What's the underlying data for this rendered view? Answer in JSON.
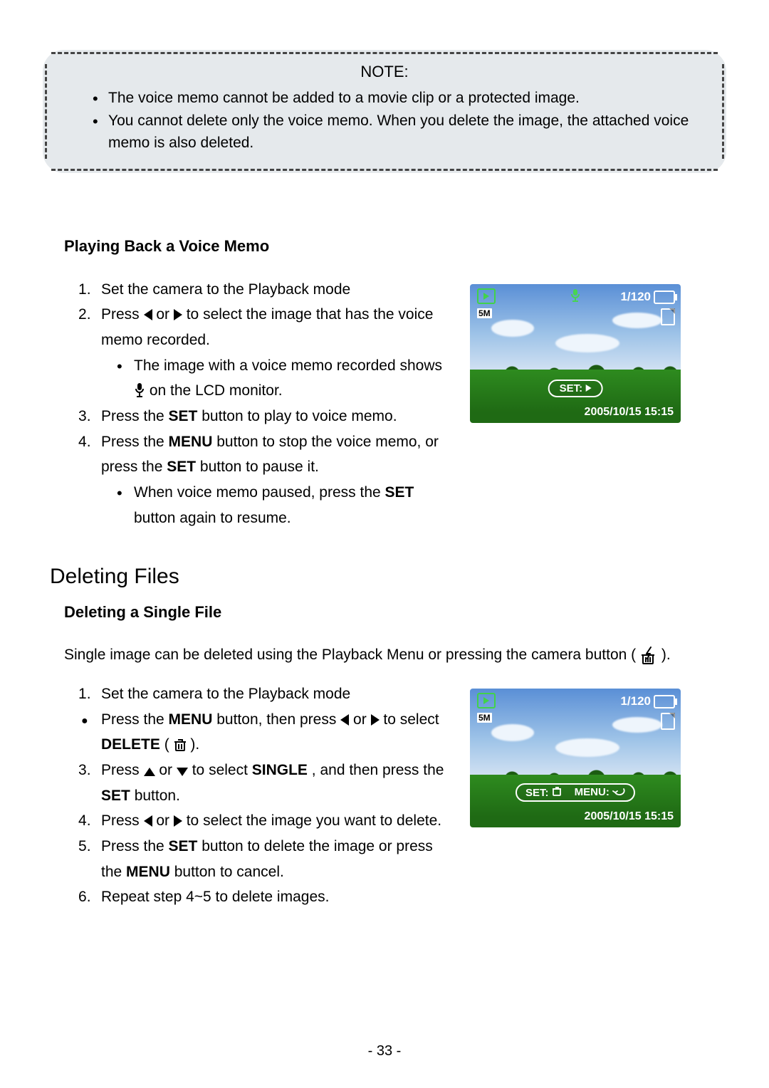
{
  "note": {
    "title": "NOTE:",
    "items": [
      "The voice memo cannot be added to a movie clip or a protected image.",
      "You cannot delete only the voice memo. When you delete the image, the attached voice memo is also deleted."
    ]
  },
  "subhead_play": "Playing Back a Voice Memo",
  "play_steps": {
    "s1": "Set the camera to the Playback mode",
    "s2a": "Press ",
    "s2b": " or ",
    "s2c": " to select the image that has the voice memo recorded.",
    "s2_bullet_a": "The image with a voice memo recorded shows ",
    "s2_bullet_b": " on the LCD monitor.",
    "s3a": "Press the ",
    "s3b": " button to play to voice memo.",
    "s4a": "Press the ",
    "s4b": " button to stop the voice memo, or press the ",
    "s4c": " button to pause it.",
    "s4_bullet_a": "When voice memo paused, press the ",
    "s4_bullet_b": " button again to resume."
  },
  "words": {
    "SET": "SET",
    "MENU": "MENU",
    "DELETE": "DELETE",
    "SINGLE": "SINGLE"
  },
  "lcd1": {
    "resolution": "5M",
    "count": "1/120",
    "pill_set": "SET:",
    "timestamp": "2005/10/15  15:15"
  },
  "section_delete": "Deleting Files",
  "subhead_del1": "Deleting a Single File",
  "del_intro_a": "Single image can be deleted using the Playback Menu or pressing the camera button ( ",
  "del_intro_b": ").",
  "del_steps": {
    "s1": "Set the camera to the Playback mode",
    "s1b_a": "Press the ",
    "s1b_b": " button, then press ",
    "s1b_c": " or ",
    "s1b_d": " to select ",
    "s1b_e": " ( ",
    "s1b_f": ").",
    "s2a": "Press ",
    "s2b": " or ",
    "s2c": " to select ",
    "s2d": ", and then press the ",
    "s2e": " button.",
    "s3a": "Press ",
    "s3b": " or ",
    "s3c": " to select the image you want to delete.",
    "s4a": "Press the ",
    "s4b": " button to delete the image or press the ",
    "s4c": " button to cancel.",
    "s5": "Repeat step 4~5 to delete images."
  },
  "lcd2": {
    "resolution": "5M",
    "count": "1/120",
    "pill_set": "SET:",
    "pill_menu": "MENU:",
    "timestamp": "2005/10/15  15:15"
  },
  "page_number": "- 33 -"
}
